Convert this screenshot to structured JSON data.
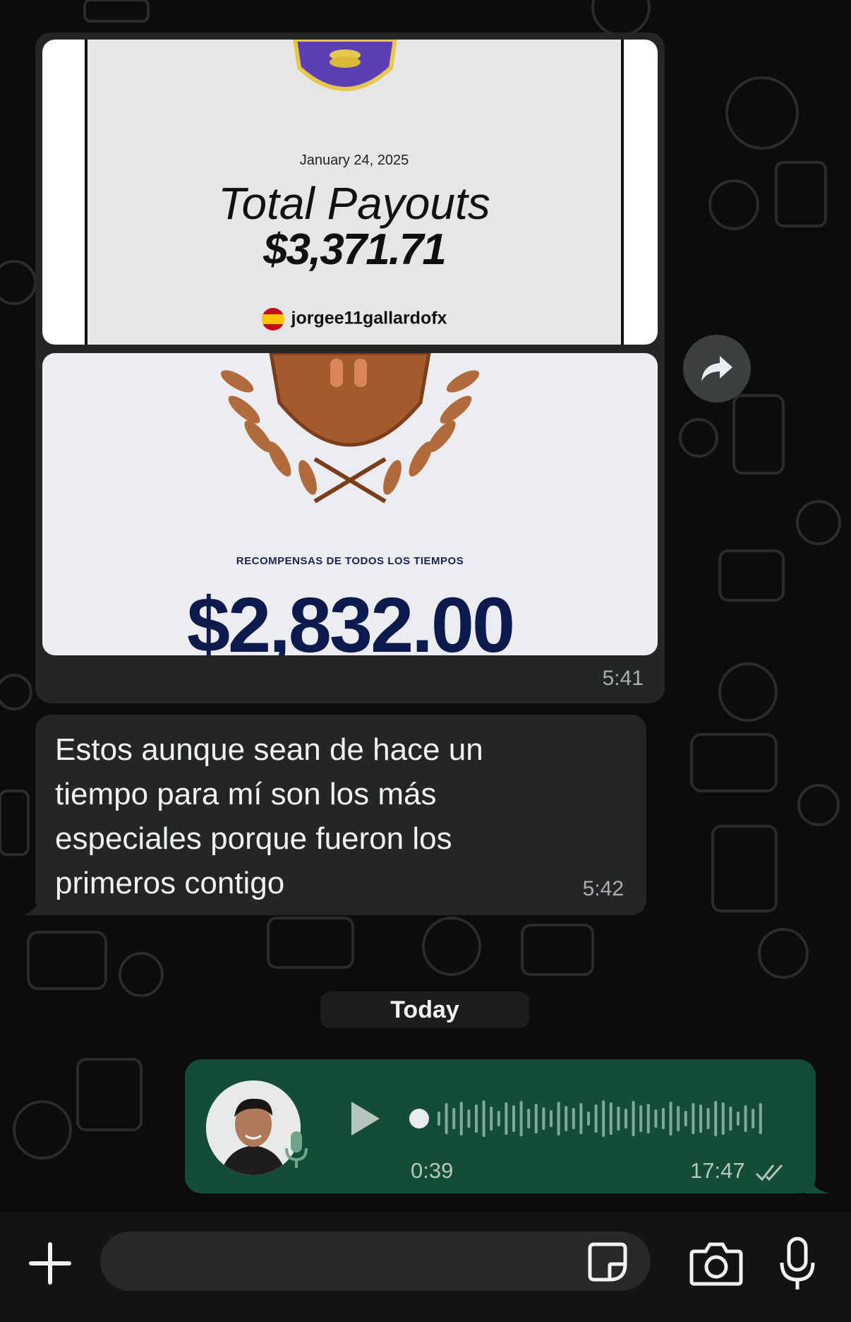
{
  "chat": {
    "image_message": {
      "image1": {
        "date": "January 24, 2025",
        "title": "Total Payouts",
        "amount": "$3,371.71",
        "username": "jorgee11gallardofx"
      },
      "image2": {
        "caption": "RECOMPENSAS DE TODOS LOS TIEMPOS",
        "amount": "$2,832.00"
      },
      "time": "5:41"
    },
    "text_message": {
      "text": "Estos aunque sean de hace un tiempo para mí son los más especiales porque fueron los primeros contigo",
      "time": "5:42"
    },
    "day_separator": "Today",
    "voice_message": {
      "duration": "0:39",
      "time": "17:47",
      "status": "read"
    }
  },
  "colors": {
    "background": "#0b0c0b",
    "incoming_bubble": "#232625",
    "outgoing_bubble": "#144d37",
    "read_ticks": "#b5c7bd"
  },
  "icons": [
    "share-forward-icon",
    "play-icon",
    "mic-icon",
    "plus-icon",
    "sticker-icon",
    "camera-icon",
    "read-ticks-icon"
  ]
}
